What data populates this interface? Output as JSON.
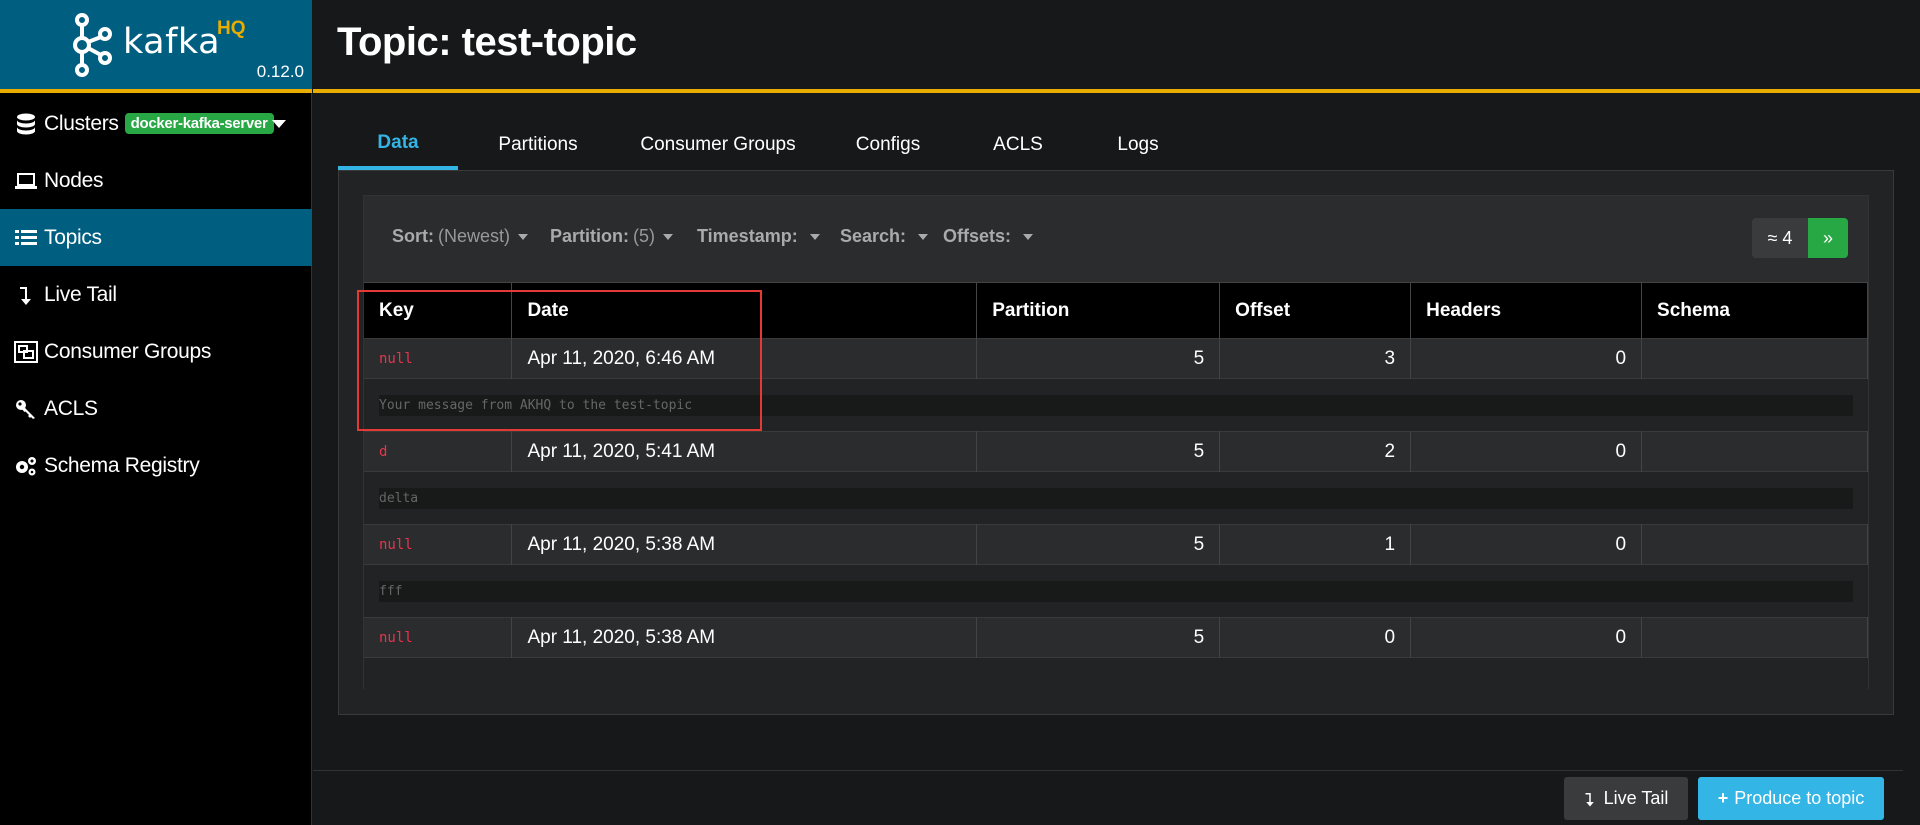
{
  "app": {
    "logo_text": "kafka",
    "logo_suffix": "HQ",
    "version": "0.12.0"
  },
  "sidebar": {
    "items": [
      {
        "label": "Clusters",
        "icon": "database-icon",
        "badge": "docker-kafka-server"
      },
      {
        "label": "Nodes",
        "icon": "laptop-icon"
      },
      {
        "label": "Topics",
        "icon": "list-icon",
        "active": true
      },
      {
        "label": "Live Tail",
        "icon": "level-down-icon"
      },
      {
        "label": "Consumer Groups",
        "icon": "object-group-icon"
      },
      {
        "label": "ACLS",
        "icon": "key-icon"
      },
      {
        "label": "Schema Registry",
        "icon": "cogs-icon"
      }
    ]
  },
  "header": {
    "title": "Topic: test-topic"
  },
  "tabs": [
    {
      "label": "Data",
      "active": true
    },
    {
      "label": "Partitions"
    },
    {
      "label": "Consumer Groups"
    },
    {
      "label": "Configs"
    },
    {
      "label": "ACLS"
    },
    {
      "label": "Logs"
    }
  ],
  "filters": {
    "sort": {
      "label": "Sort:",
      "value": "(Newest)"
    },
    "partition": {
      "label": "Partition:",
      "value": "(5)"
    },
    "timestamp": {
      "label": "Timestamp:"
    },
    "search": {
      "label": "Search:"
    },
    "offsets": {
      "label": "Offsets:"
    }
  },
  "pagination": {
    "count": "≈ 4",
    "next": "»"
  },
  "table": {
    "headers": [
      "Key",
      "Date",
      "Partition",
      "Offset",
      "Headers",
      "Schema"
    ],
    "rows": [
      {
        "key": "null",
        "date": "Apr 11, 2020, 6:46 AM",
        "partition": "5",
        "offset": "3",
        "headers": "0",
        "schema": "",
        "message": "Your message from AKHQ to the test-topic"
      },
      {
        "key": "d",
        "date": "Apr 11, 2020, 5:41 AM",
        "partition": "5",
        "offset": "2",
        "headers": "0",
        "schema": "",
        "message": "delta"
      },
      {
        "key": "null",
        "date": "Apr 11, 2020, 5:38 AM",
        "partition": "5",
        "offset": "1",
        "headers": "0",
        "schema": "",
        "message": "fff"
      },
      {
        "key": "null",
        "date": "Apr 11, 2020, 5:38 AM",
        "partition": "5",
        "offset": "0",
        "headers": "0",
        "schema": "",
        "message": ""
      }
    ]
  },
  "footer": {
    "live_tail": "Live Tail",
    "produce": "Produce to topic"
  },
  "colors": {
    "brand": "#005f81",
    "accent": "#e9ac00",
    "tab_active": "#33b5e5",
    "badge": "#28a745",
    "key_text": "#e8344e"
  }
}
